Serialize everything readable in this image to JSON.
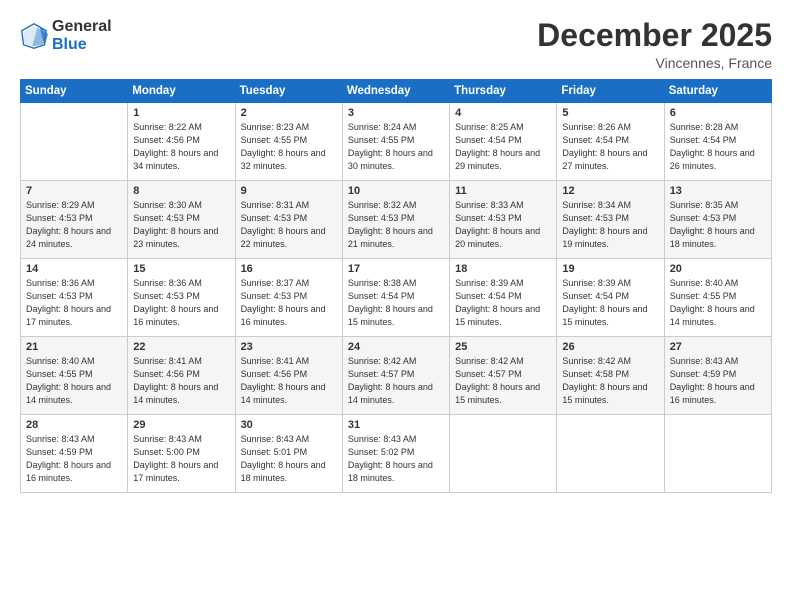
{
  "header": {
    "logo": {
      "general": "General",
      "blue": "Blue"
    },
    "title": "December 2025",
    "subtitle": "Vincennes, France"
  },
  "days_of_week": [
    "Sunday",
    "Monday",
    "Tuesday",
    "Wednesday",
    "Thursday",
    "Friday",
    "Saturday"
  ],
  "weeks": [
    [
      {
        "day": "",
        "info": ""
      },
      {
        "day": "1",
        "info": "Sunrise: 8:22 AM\nSunset: 4:56 PM\nDaylight: 8 hours\nand 34 minutes."
      },
      {
        "day": "2",
        "info": "Sunrise: 8:23 AM\nSunset: 4:55 PM\nDaylight: 8 hours\nand 32 minutes."
      },
      {
        "day": "3",
        "info": "Sunrise: 8:24 AM\nSunset: 4:55 PM\nDaylight: 8 hours\nand 30 minutes."
      },
      {
        "day": "4",
        "info": "Sunrise: 8:25 AM\nSunset: 4:54 PM\nDaylight: 8 hours\nand 29 minutes."
      },
      {
        "day": "5",
        "info": "Sunrise: 8:26 AM\nSunset: 4:54 PM\nDaylight: 8 hours\nand 27 minutes."
      },
      {
        "day": "6",
        "info": "Sunrise: 8:28 AM\nSunset: 4:54 PM\nDaylight: 8 hours\nand 26 minutes."
      }
    ],
    [
      {
        "day": "7",
        "info": "Sunrise: 8:29 AM\nSunset: 4:53 PM\nDaylight: 8 hours\nand 24 minutes."
      },
      {
        "day": "8",
        "info": "Sunrise: 8:30 AM\nSunset: 4:53 PM\nDaylight: 8 hours\nand 23 minutes."
      },
      {
        "day": "9",
        "info": "Sunrise: 8:31 AM\nSunset: 4:53 PM\nDaylight: 8 hours\nand 22 minutes."
      },
      {
        "day": "10",
        "info": "Sunrise: 8:32 AM\nSunset: 4:53 PM\nDaylight: 8 hours\nand 21 minutes."
      },
      {
        "day": "11",
        "info": "Sunrise: 8:33 AM\nSunset: 4:53 PM\nDaylight: 8 hours\nand 20 minutes."
      },
      {
        "day": "12",
        "info": "Sunrise: 8:34 AM\nSunset: 4:53 PM\nDaylight: 8 hours\nand 19 minutes."
      },
      {
        "day": "13",
        "info": "Sunrise: 8:35 AM\nSunset: 4:53 PM\nDaylight: 8 hours\nand 18 minutes."
      }
    ],
    [
      {
        "day": "14",
        "info": "Sunrise: 8:36 AM\nSunset: 4:53 PM\nDaylight: 8 hours\nand 17 minutes."
      },
      {
        "day": "15",
        "info": "Sunrise: 8:36 AM\nSunset: 4:53 PM\nDaylight: 8 hours\nand 16 minutes."
      },
      {
        "day": "16",
        "info": "Sunrise: 8:37 AM\nSunset: 4:53 PM\nDaylight: 8 hours\nand 16 minutes."
      },
      {
        "day": "17",
        "info": "Sunrise: 8:38 AM\nSunset: 4:54 PM\nDaylight: 8 hours\nand 15 minutes."
      },
      {
        "day": "18",
        "info": "Sunrise: 8:39 AM\nSunset: 4:54 PM\nDaylight: 8 hours\nand 15 minutes."
      },
      {
        "day": "19",
        "info": "Sunrise: 8:39 AM\nSunset: 4:54 PM\nDaylight: 8 hours\nand 15 minutes."
      },
      {
        "day": "20",
        "info": "Sunrise: 8:40 AM\nSunset: 4:55 PM\nDaylight: 8 hours\nand 14 minutes."
      }
    ],
    [
      {
        "day": "21",
        "info": "Sunrise: 8:40 AM\nSunset: 4:55 PM\nDaylight: 8 hours\nand 14 minutes."
      },
      {
        "day": "22",
        "info": "Sunrise: 8:41 AM\nSunset: 4:56 PM\nDaylight: 8 hours\nand 14 minutes."
      },
      {
        "day": "23",
        "info": "Sunrise: 8:41 AM\nSunset: 4:56 PM\nDaylight: 8 hours\nand 14 minutes."
      },
      {
        "day": "24",
        "info": "Sunrise: 8:42 AM\nSunset: 4:57 PM\nDaylight: 8 hours\nand 14 minutes."
      },
      {
        "day": "25",
        "info": "Sunrise: 8:42 AM\nSunset: 4:57 PM\nDaylight: 8 hours\nand 15 minutes."
      },
      {
        "day": "26",
        "info": "Sunrise: 8:42 AM\nSunset: 4:58 PM\nDaylight: 8 hours\nand 15 minutes."
      },
      {
        "day": "27",
        "info": "Sunrise: 8:43 AM\nSunset: 4:59 PM\nDaylight: 8 hours\nand 16 minutes."
      }
    ],
    [
      {
        "day": "28",
        "info": "Sunrise: 8:43 AM\nSunset: 4:59 PM\nDaylight: 8 hours\nand 16 minutes."
      },
      {
        "day": "29",
        "info": "Sunrise: 8:43 AM\nSunset: 5:00 PM\nDaylight: 8 hours\nand 17 minutes."
      },
      {
        "day": "30",
        "info": "Sunrise: 8:43 AM\nSunset: 5:01 PM\nDaylight: 8 hours\nand 18 minutes."
      },
      {
        "day": "31",
        "info": "Sunrise: 8:43 AM\nSunset: 5:02 PM\nDaylight: 8 hours\nand 18 minutes."
      },
      {
        "day": "",
        "info": ""
      },
      {
        "day": "",
        "info": ""
      },
      {
        "day": "",
        "info": ""
      }
    ]
  ]
}
